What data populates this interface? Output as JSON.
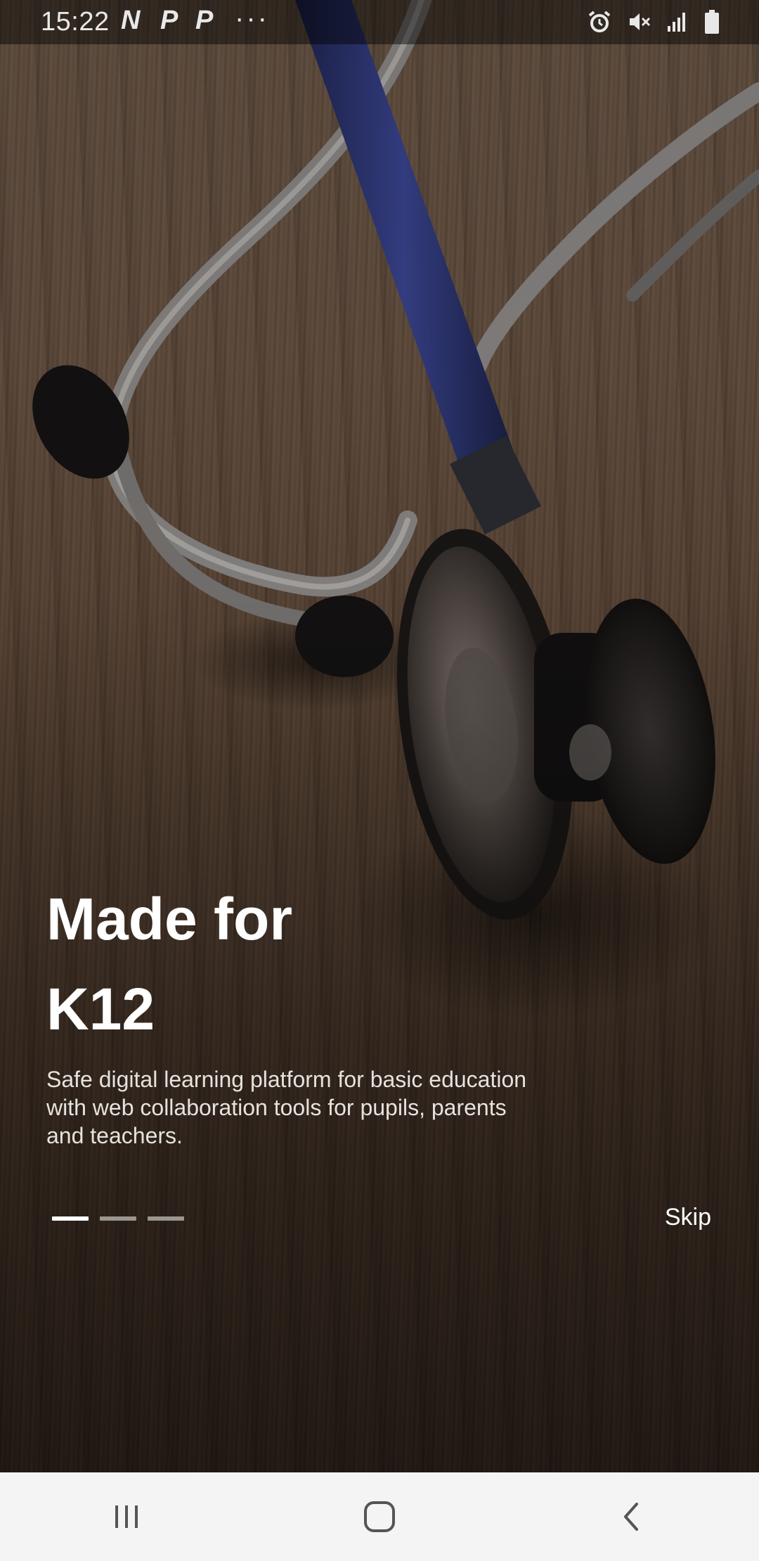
{
  "status_bar": {
    "time": "15:22",
    "app_icons": [
      "N",
      "P",
      "P"
    ],
    "overflow": "···",
    "icons": [
      "alarm-icon",
      "mute-icon",
      "signal-icon",
      "battery-icon"
    ]
  },
  "onboarding": {
    "title_line1": "Made for",
    "title_line2": "K12",
    "description": "Safe digital learning platform for basic education with web collaboration tools for pupils, parents and teachers.",
    "page_count": 3,
    "current_page": 1,
    "skip_label": "Skip"
  },
  "nav_bar": {
    "buttons": [
      "recents-icon",
      "home-icon",
      "back-icon"
    ]
  },
  "colors": {
    "title": "#ffffff",
    "description": "#e6e2de",
    "pager_active": "#ffffff",
    "pager_inactive": "#9b9590",
    "nav_background": "#f4f4f4",
    "nav_icon": "#555555"
  }
}
